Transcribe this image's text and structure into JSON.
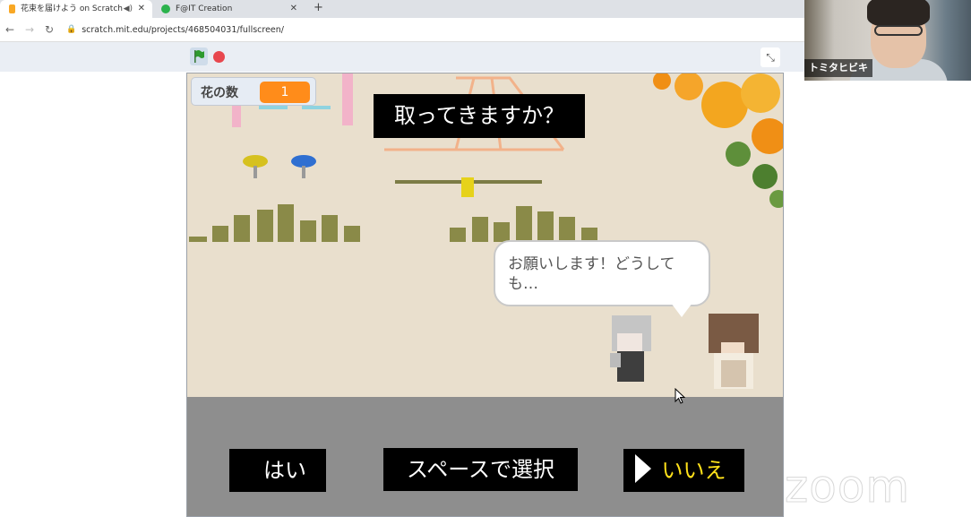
{
  "browser": {
    "tabs": [
      {
        "title": "花束を届けよう on Scratch"
      },
      {
        "title": "F@IT Creation"
      }
    ],
    "new_tab": "+",
    "close": "✕",
    "url": "scratch.mit.edu/projects/468504031/fullscreen/"
  },
  "webcam": {
    "name": "トミタヒビキ"
  },
  "stage": {
    "counter_label": "花の数",
    "counter_value": "1",
    "question": "取ってきますか？",
    "speech": "お願いします！どうしても…",
    "option_yes": "はい",
    "hint": "スペースで選択",
    "option_no": "いいえ"
  },
  "watermark": "zoom",
  "colors": {
    "counter_value_bg": "#ff8c1a",
    "selected_option_text": "#ffe11a",
    "stop_button": "#e8474e",
    "flag": "#2e9a2e"
  }
}
